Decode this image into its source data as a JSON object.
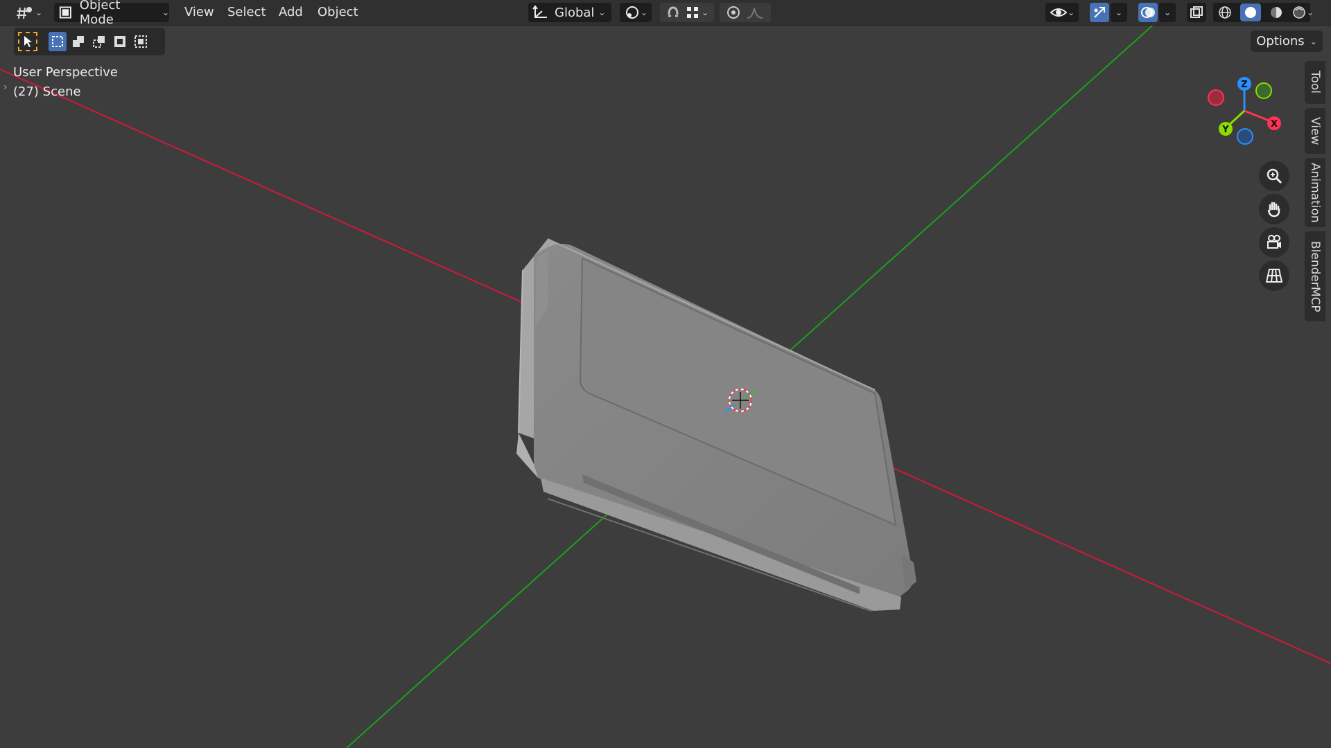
{
  "header": {
    "mode_label": "Object Mode",
    "menus": [
      "View",
      "Select",
      "Add",
      "Object"
    ],
    "orientation_label": "Global"
  },
  "toolbar": {
    "options_label": "Options"
  },
  "viewport": {
    "perspective_label": "User Perspective",
    "scene_label": "(27) Scene"
  },
  "gizmo": {
    "x": "X",
    "y": "Y",
    "z": "Z"
  },
  "side_tabs": [
    "Tool",
    "View",
    "Animation",
    "BlenderMCP"
  ],
  "icons": {
    "editor_type": "editor-type-icon",
    "mode": "object-mode-icon",
    "orientation": "transform-orientation-icon",
    "pivot": "pivot-point-icon",
    "snap": "snap-icon",
    "proportional": "proportional-edit-icon",
    "visibility": "eye-icon",
    "gizmo_toggle": "gizmo-toggle-icon",
    "overlays": "overlays-icon",
    "xray": "xray-icon",
    "shading": [
      "wireframe-icon",
      "solid-shading-icon",
      "material-preview-icon",
      "rendered-shading-icon"
    ],
    "nav": [
      "zoom-icon",
      "pan-hand-icon",
      "camera-icon",
      "grid-view-icon"
    ]
  },
  "colors": {
    "accent": "#4772b3",
    "x_axis": "#ff3352",
    "y_axis": "#8bdc00",
    "z_axis": "#2890ff",
    "selection_outline": "#f5a623"
  }
}
